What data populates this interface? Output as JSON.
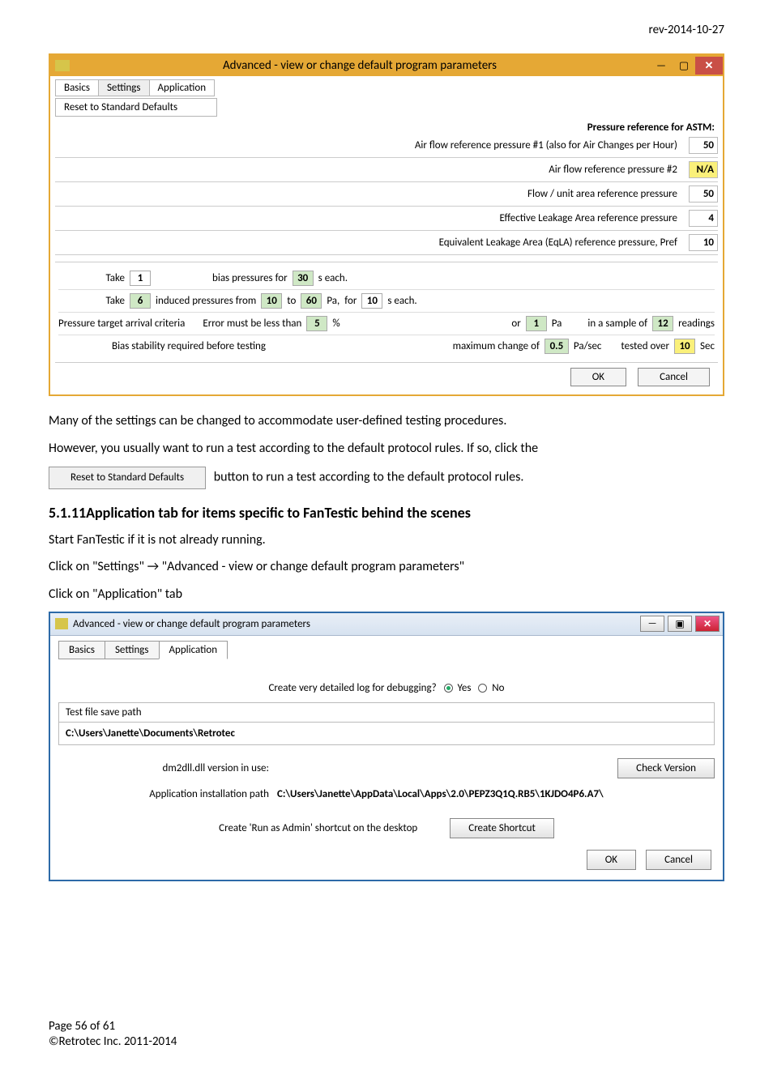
{
  "header": {
    "revision": "rev-2014-10-27"
  },
  "window1": {
    "title": "Advanced - view or change default program parameters",
    "tabs": {
      "basics": "Basics",
      "settings": "Settings",
      "application": "Application"
    },
    "reset_label": "Reset to Standard Defaults",
    "pressure_header": "Pressure reference for ASTM:",
    "rows": [
      {
        "label": "Air flow reference pressure #1 (also for Air Changes per Hour)",
        "value": "50"
      },
      {
        "label": "Air flow reference pressure #2",
        "value": "N/A",
        "hl": true
      },
      {
        "label": "Flow / unit area reference pressure",
        "value": "50"
      },
      {
        "label": "Effective Leakage Area reference pressure",
        "value": "4"
      },
      {
        "label": "Equivalent Leakage Area (EqLA) reference pressure, Pref",
        "value": "10"
      }
    ],
    "cfg": {
      "take1_label": "Take",
      "take1_val": "1",
      "bias_label": "bias pressures for",
      "bias_val": "30",
      "each_label": "s each.",
      "take2_label": "Take",
      "take2_val": "6",
      "induced_label": "induced pressures from",
      "from_val": "10",
      "to_label": "to",
      "to_val": "60",
      "pa_label": "Pa,",
      "for_label": "for",
      "for_val": "10",
      "each_label2": "s each.",
      "criteria_head": "Pressure target arrival criteria",
      "err_label": "Error must be less than",
      "err_val": "5",
      "pct": "%",
      "or_label": "or",
      "or_val": "1",
      "pa2": "Pa",
      "sample_label": "in a sample of",
      "sample_val": "12",
      "readings": "readings",
      "bias_hdr": "Bias stability required before testing",
      "max_label": "maximum change of",
      "max_val": "0.5",
      "pasec": "Pa/sec",
      "tested_label": "tested over",
      "tested_val": "10",
      "sec": "Sec"
    },
    "ok": "OK",
    "cancel": "Cancel"
  },
  "paras": {
    "p1": "Many of the settings can be changed to accommodate user-defined testing procedures.",
    "p2": "However, you usually want to run a test according to the default protocol rules.  If so, click the",
    "btn": "Reset to Standard Defaults",
    "p3": "button to run a test according to the default protocol rules."
  },
  "section": {
    "num": "5.1.11",
    "title": "Application tab for items specific to FanTestic behind the scenes",
    "l1": "Start FanTestic if it is not already running.",
    "l2a": "Click on \"Settings\" ",
    "arrow": "→",
    "l2b": " \"Advanced - view or change default program parameters\"",
    "l3": "Click on \"Application\" tab"
  },
  "window2": {
    "title": "Advanced - view or change default program parameters",
    "tabs": {
      "basics": "Basics",
      "settings": "Settings",
      "application": "Application"
    },
    "debug_label": "Create very detailed log for debugging?",
    "yes": "Yes",
    "no": "No",
    "testfile_header": "Test file save path",
    "testfile_value": "C:\\Users\\Janette\\Documents\\Retrotec",
    "dll_label": "dm2dll.dll version in use:",
    "check_btn": "Check Version",
    "install_label": "Application installation path",
    "install_value": "C:\\Users\\Janette\\AppData\\Local\\Apps\\2.0\\PEPZ3Q1Q.RB5\\1KJDO4P6.A7\\",
    "shortcut_label": "Create 'Run as Admin' shortcut on the desktop",
    "shortcut_btn": "Create Shortcut",
    "ok": "OK",
    "cancel": "Cancel"
  },
  "footer": {
    "page": "Page 56 of 61",
    "copy": "©Retrotec Inc. 2011-2014"
  }
}
